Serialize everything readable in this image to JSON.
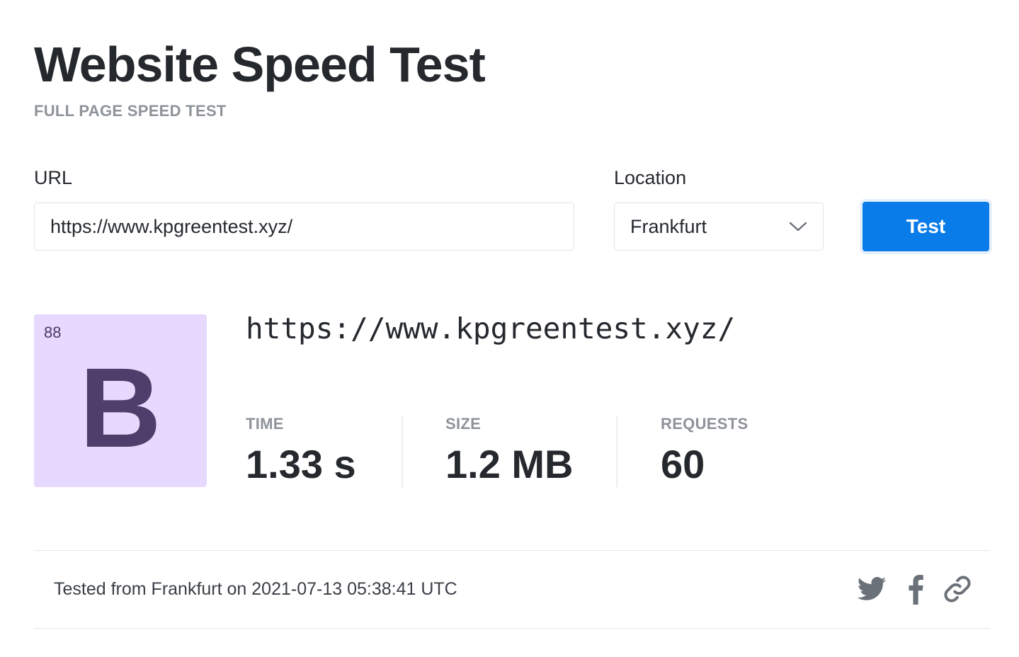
{
  "header": {
    "title": "Website Speed Test",
    "subtitle": "FULL PAGE SPEED TEST"
  },
  "form": {
    "url_label": "URL",
    "url_value": "https://www.kpgreentest.xyz/",
    "location_label": "Location",
    "location_value": "Frankfurt",
    "test_button_label": "Test"
  },
  "result": {
    "grade_score": "88",
    "grade_letter": "B",
    "url": "https://www.kpgreentest.xyz/",
    "metrics": [
      {
        "label": "TIME",
        "value": "1.33 s"
      },
      {
        "label": "SIZE",
        "value": "1.2 MB"
      },
      {
        "label": "REQUESTS",
        "value": "60"
      }
    ]
  },
  "footer": {
    "tested_text": "Tested from Frankfurt on 2021-07-13 05:38:41 UTC",
    "share_icons": [
      "twitter-icon",
      "facebook-icon",
      "link-icon"
    ]
  },
  "colors": {
    "accent": "#0a7ce9",
    "grade_bg": "#e7d9fe",
    "grade_fg": "#4e3e6b",
    "muted": "#8e939a",
    "icon": "#6b7178"
  }
}
